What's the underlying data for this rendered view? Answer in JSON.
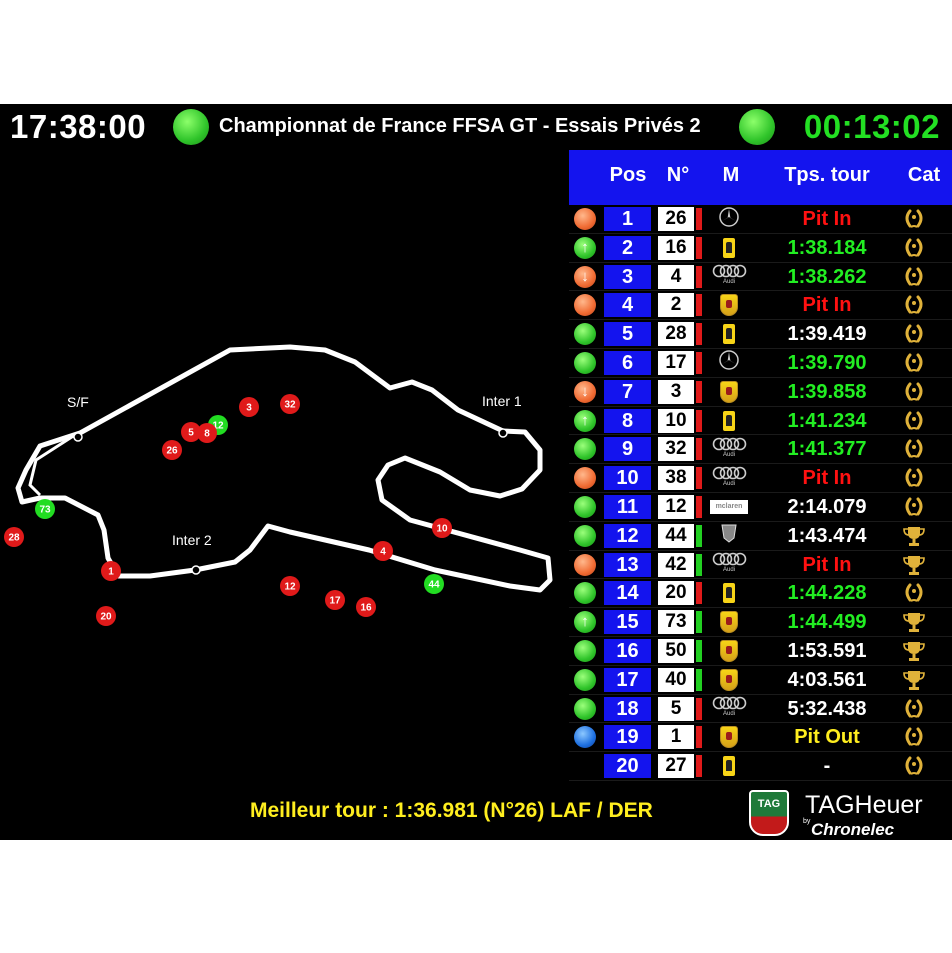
{
  "header": {
    "clock_time": "17:38:00",
    "session_title": "Championnat de France FFSA GT - Essais Privés 2",
    "remaining_time": "00:13:02",
    "flag_color": "#2fc42a"
  },
  "map": {
    "labels": {
      "start_finish": "S/F",
      "inter1": "Inter 1",
      "inter2": "Inter 2"
    },
    "cars": [
      {
        "num": "3",
        "color": "red"
      },
      {
        "num": "32",
        "color": "red"
      },
      {
        "num": "12",
        "color": "green"
      },
      {
        "num": "8",
        "color": "red"
      },
      {
        "num": "5",
        "color": "red"
      },
      {
        "num": "26",
        "color": "red"
      },
      {
        "num": "73",
        "color": "green"
      },
      {
        "num": "28",
        "color": "red"
      },
      {
        "num": "1",
        "color": "red"
      },
      {
        "num": "20",
        "color": "red"
      },
      {
        "num": "12",
        "color": "red"
      },
      {
        "num": "17",
        "color": "red"
      },
      {
        "num": "16",
        "color": "red"
      },
      {
        "num": "10",
        "color": "red"
      },
      {
        "num": "4",
        "color": "red"
      },
      {
        "num": "44",
        "color": "green"
      }
    ]
  },
  "table": {
    "headers": {
      "pos": "Pos",
      "num": "N°",
      "make": "M",
      "lap": "Tps. tour",
      "cat": "Cat"
    },
    "rows": [
      {
        "pos": "1",
        "num": "26",
        "status": "orange",
        "arrow": "",
        "stripe": "red",
        "make": "mercedes-icon",
        "lap": "Pit In",
        "lap_color": "#ff1111",
        "cat": "laurel-icon"
      },
      {
        "pos": "2",
        "num": "16",
        "status": "green",
        "arrow": "up",
        "stripe": "red",
        "make": "ferrari-icon",
        "lap": "1:38.184",
        "lap_color": "#22ee22",
        "cat": "laurel-icon"
      },
      {
        "pos": "3",
        "num": "4",
        "status": "orange",
        "arrow": "down",
        "stripe": "red",
        "make": "audi-icon",
        "lap": "1:38.262",
        "lap_color": "#22ee22",
        "cat": "laurel-icon"
      },
      {
        "pos": "4",
        "num": "2",
        "status": "orange",
        "arrow": "",
        "stripe": "red",
        "make": "porsche-icon",
        "lap": "Pit In",
        "lap_color": "#ff1111",
        "cat": "laurel-icon"
      },
      {
        "pos": "5",
        "num": "28",
        "status": "green",
        "arrow": "",
        "stripe": "red",
        "make": "ferrari-icon",
        "lap": "1:39.419",
        "lap_color": "#ffffff",
        "cat": "laurel-icon"
      },
      {
        "pos": "6",
        "num": "17",
        "status": "green",
        "arrow": "",
        "stripe": "red",
        "make": "mercedes-icon",
        "lap": "1:39.790",
        "lap_color": "#22ee22",
        "cat": "laurel-icon"
      },
      {
        "pos": "7",
        "num": "3",
        "status": "orange",
        "arrow": "down",
        "stripe": "red",
        "make": "porsche-icon",
        "lap": "1:39.858",
        "lap_color": "#22ee22",
        "cat": "laurel-icon"
      },
      {
        "pos": "8",
        "num": "10",
        "status": "green",
        "arrow": "up",
        "stripe": "red",
        "make": "ferrari-icon",
        "lap": "1:41.234",
        "lap_color": "#22ee22",
        "cat": "laurel-icon"
      },
      {
        "pos": "9",
        "num": "32",
        "status": "green",
        "arrow": "",
        "stripe": "red",
        "make": "audi-icon",
        "lap": "1:41.377",
        "lap_color": "#22ee22",
        "cat": "laurel-icon"
      },
      {
        "pos": "10",
        "num": "38",
        "status": "orange",
        "arrow": "",
        "stripe": "red",
        "make": "audi-icon",
        "lap": "Pit In",
        "lap_color": "#ff1111",
        "cat": "laurel-icon"
      },
      {
        "pos": "11",
        "num": "12",
        "status": "green",
        "arrow": "",
        "stripe": "red",
        "make": "mclaren-icon",
        "lap": "2:14.079",
        "lap_color": "#ffffff",
        "cat": "laurel-icon"
      },
      {
        "pos": "12",
        "num": "44",
        "status": "green",
        "arrow": "",
        "stripe": "green",
        "make": "dodge-icon",
        "lap": "1:43.474",
        "lap_color": "#ffffff",
        "cat": "trophy-icon"
      },
      {
        "pos": "13",
        "num": "42",
        "status": "orange",
        "arrow": "",
        "stripe": "green",
        "make": "audi-icon",
        "lap": "Pit In",
        "lap_color": "#ff1111",
        "cat": "trophy-icon"
      },
      {
        "pos": "14",
        "num": "20",
        "status": "green",
        "arrow": "",
        "stripe": "red",
        "make": "ferrari-icon",
        "lap": "1:44.228",
        "lap_color": "#22ee22",
        "cat": "laurel-icon"
      },
      {
        "pos": "15",
        "num": "73",
        "status": "green",
        "arrow": "up",
        "stripe": "green",
        "make": "porsche-icon",
        "lap": "1:44.499",
        "lap_color": "#22ee22",
        "cat": "trophy-icon"
      },
      {
        "pos": "16",
        "num": "50",
        "status": "green",
        "arrow": "",
        "stripe": "green",
        "make": "porsche-icon",
        "lap": "1:53.591",
        "lap_color": "#ffffff",
        "cat": "trophy-icon"
      },
      {
        "pos": "17",
        "num": "40",
        "status": "green",
        "arrow": "",
        "stripe": "green",
        "make": "porsche-icon",
        "lap": "4:03.561",
        "lap_color": "#ffffff",
        "cat": "trophy-icon"
      },
      {
        "pos": "18",
        "num": "5",
        "status": "green",
        "arrow": "",
        "stripe": "red",
        "make": "audi-icon",
        "lap": "5:32.438",
        "lap_color": "#ffffff",
        "cat": "laurel-icon"
      },
      {
        "pos": "19",
        "num": "1",
        "status": "blue",
        "arrow": "",
        "stripe": "red",
        "make": "porsche-icon",
        "lap": "Pit Out",
        "lap_color": "#ffee1f",
        "cat": "laurel-icon"
      },
      {
        "pos": "20",
        "num": "27",
        "status": "none",
        "arrow": "",
        "stripe": "red",
        "make": "ferrari-icon",
        "lap": "-",
        "lap_color": "#ffffff",
        "cat": "laurel-icon"
      }
    ]
  },
  "footer": {
    "best_lap": "Meilleur tour : 1:36.981 (N°26) LAF / DER",
    "logo_tag": "TAG",
    "logo_heuer": "HEUER",
    "logo_brand": "TAGHeuer",
    "logo_by": "by",
    "logo_chronelec": "Chronelec"
  },
  "colors": {
    "table_blue": "#1414ee",
    "best_lap_yellow": "#ffee1f",
    "remaining_green": "#23e023",
    "stripe_red": "#e01a1a",
    "stripe_green": "#22d022"
  }
}
